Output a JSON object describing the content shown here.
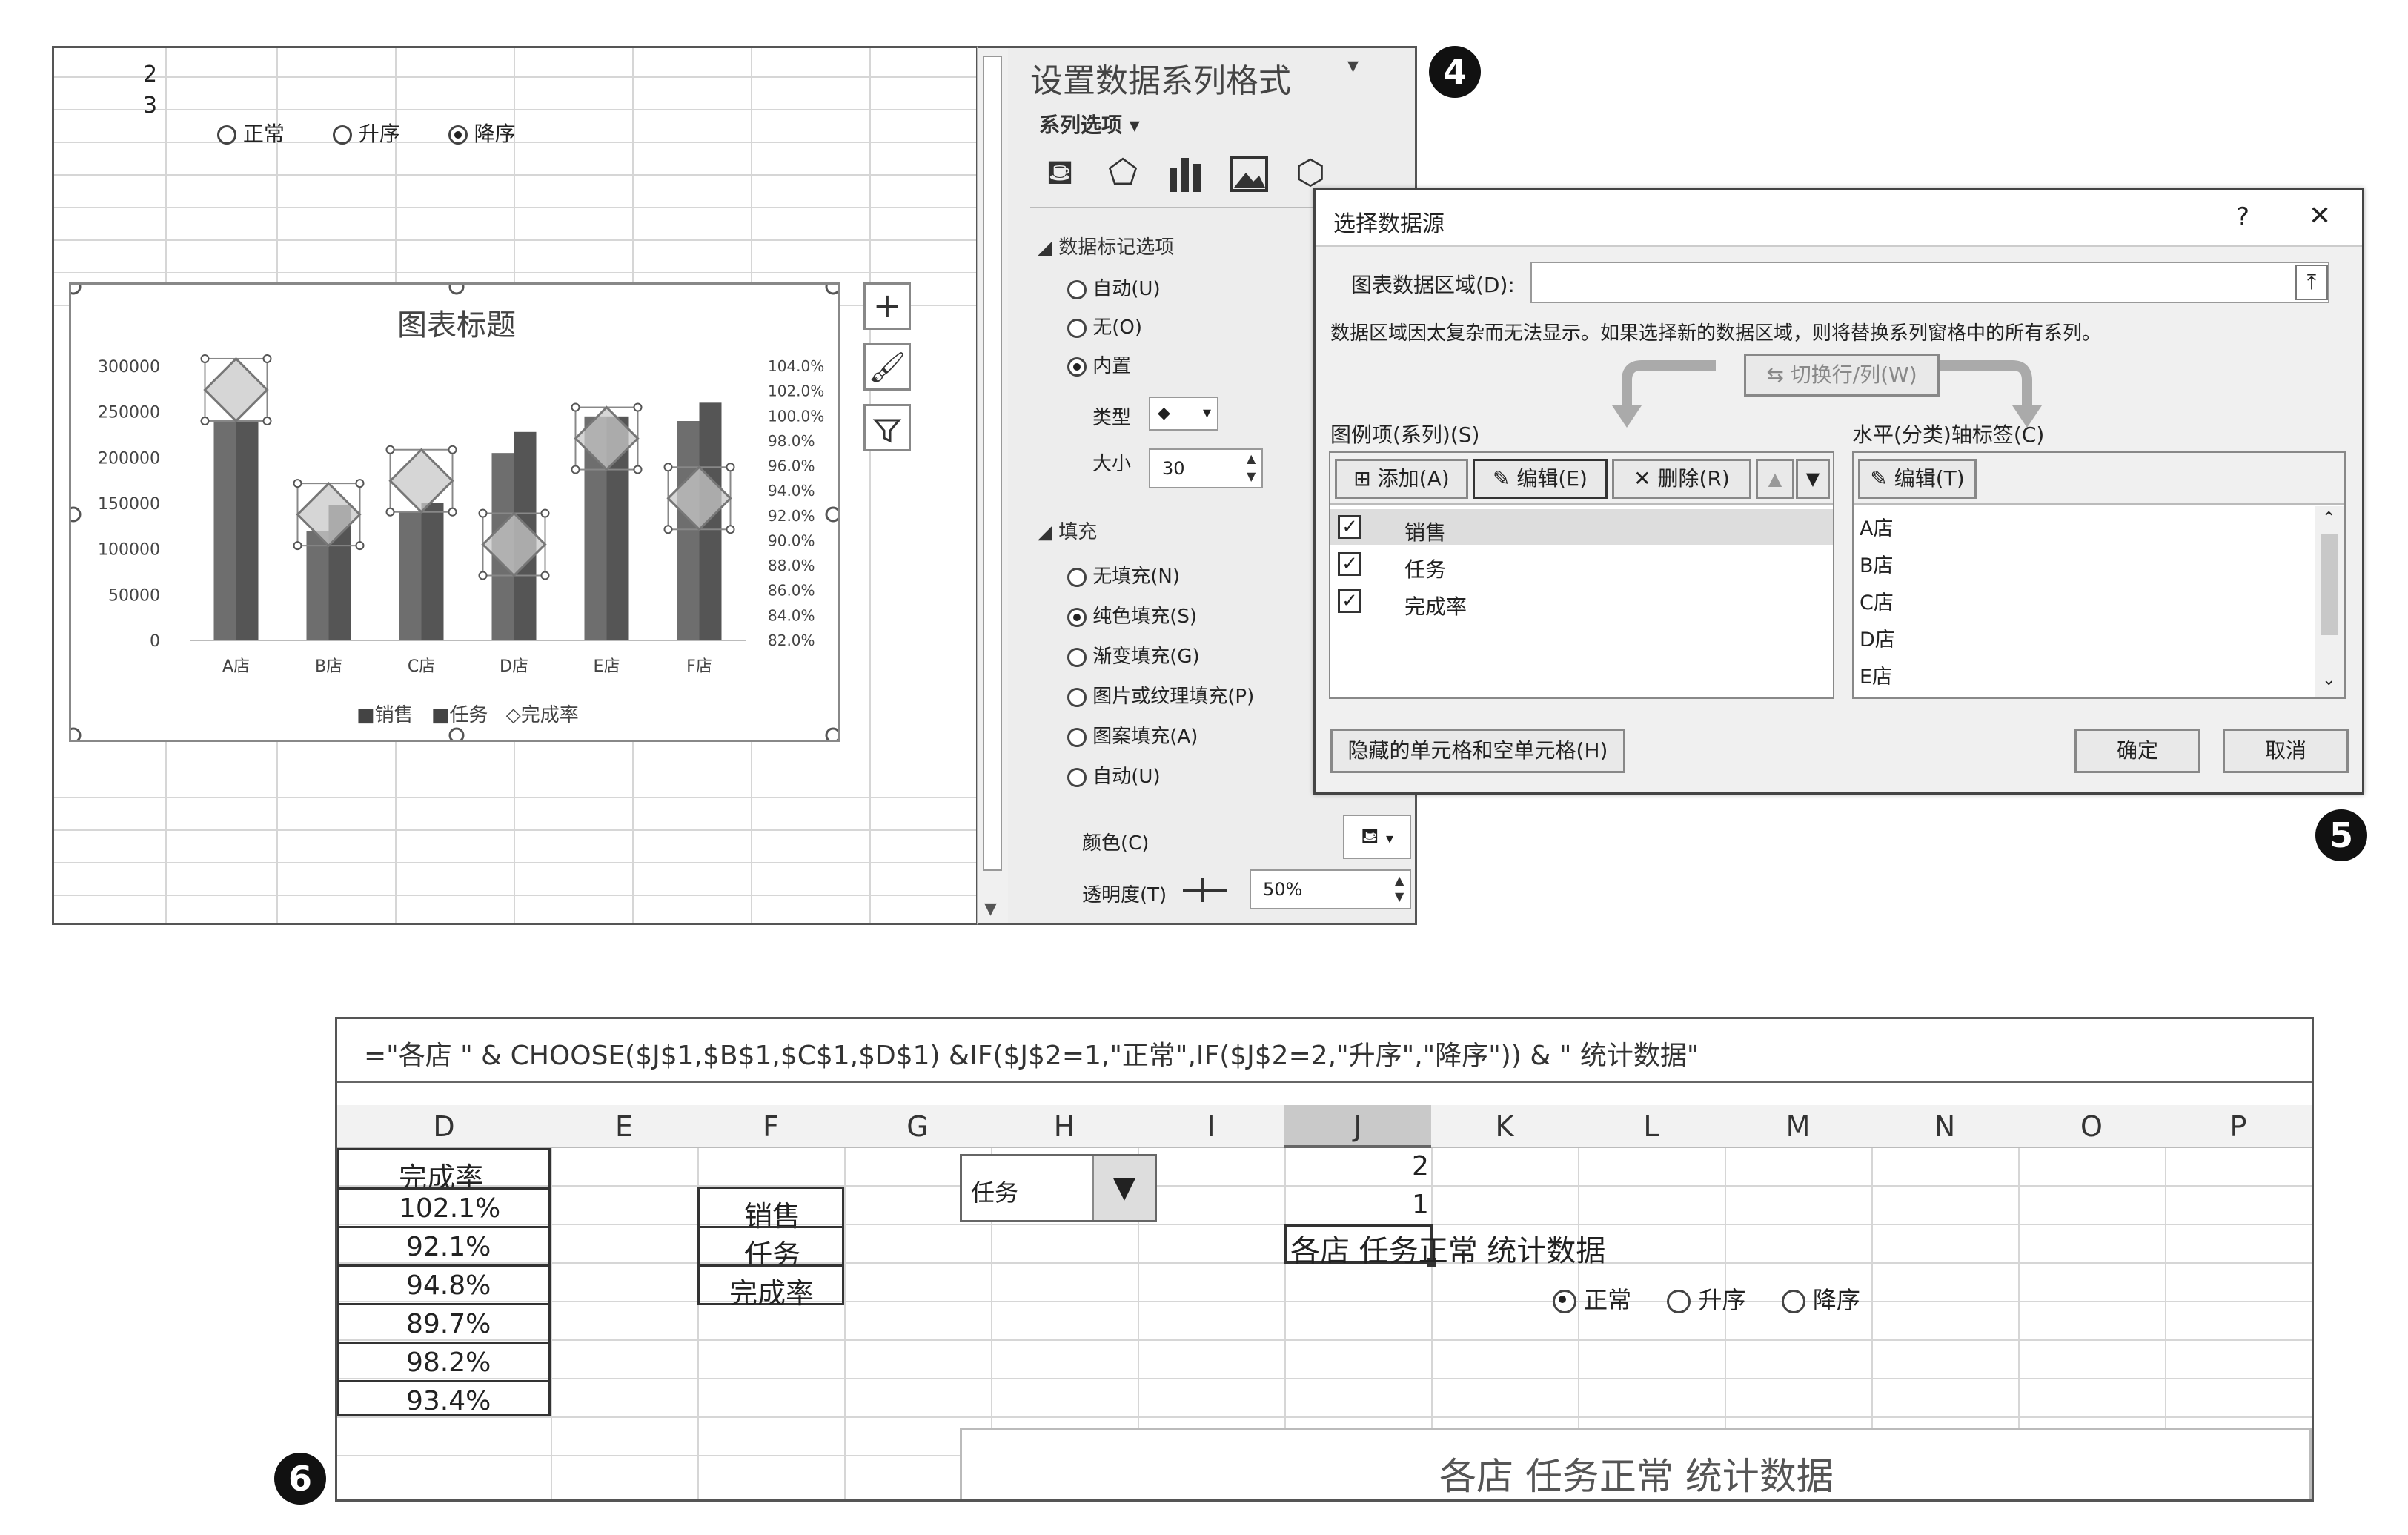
{
  "badges": {
    "step4": "4",
    "step5": "5",
    "step6": "6"
  },
  "sheet_top": {
    "row_numbers": [
      "2",
      "3"
    ],
    "radio_options": [
      {
        "label": "正常",
        "selected": false
      },
      {
        "label": "升序",
        "selected": false
      },
      {
        "label": "降序",
        "selected": true
      }
    ]
  },
  "chart": {
    "title": "图表标题",
    "legend": [
      "销售",
      "任务",
      "完成率"
    ],
    "side_buttons": [
      "plus-icon",
      "brush-icon",
      "filter-icon"
    ]
  },
  "chart_data": {
    "type": "bar",
    "title": "图表标题",
    "categories": [
      "A店",
      "B店",
      "C店",
      "D店",
      "E店",
      "F店"
    ],
    "series": [
      {
        "name": "销售",
        "type": "bar",
        "axis": "left",
        "values": [
          240000,
          120000,
          140000,
          205000,
          245000,
          240000
        ]
      },
      {
        "name": "任务",
        "type": "bar",
        "axis": "left",
        "values": [
          240000,
          148000,
          150000,
          228000,
          245000,
          260000
        ]
      },
      {
        "name": "完成率",
        "type": "scatter",
        "axis": "right",
        "values": [
          1.021,
          0.921,
          0.948,
          0.897,
          0.982,
          0.934
        ]
      }
    ],
    "y_left": {
      "min": 0,
      "max": 300000,
      "ticks": [
        "0",
        "50000",
        "100000",
        "150000",
        "200000",
        "250000",
        "300000"
      ]
    },
    "y_right": {
      "min": 0.82,
      "max": 1.04,
      "ticks": [
        "82.0%",
        "84.0%",
        "86.0%",
        "88.0%",
        "90.0%",
        "92.0%",
        "94.0%",
        "96.0%",
        "98.0%",
        "100.0%",
        "102.0%",
        "104.0%"
      ]
    },
    "legend_position": "bottom"
  },
  "format_pane": {
    "title": "设置数据系列格式",
    "subtitle": "系列选项",
    "section_marker": "数据标记选项",
    "marker_options": [
      {
        "label": "自动(U)",
        "selected": false
      },
      {
        "label": "无(O)",
        "selected": false
      },
      {
        "label": "内置",
        "selected": true
      }
    ],
    "type_label": "类型",
    "type_value": "◆",
    "size_label": "大小",
    "size_value": "30",
    "fill_section": "填充",
    "fill_options": [
      {
        "label": "无填充(N)",
        "selected": false
      },
      {
        "label": "纯色填充(S)",
        "selected": true
      },
      {
        "label": "渐变填充(G)",
        "selected": false
      },
      {
        "label": "图片或纹理填充(P)",
        "selected": false
      },
      {
        "label": "图案填充(A)",
        "selected": false
      },
      {
        "label": "自动(U)",
        "selected": false
      }
    ],
    "color_label": "颜色(C)",
    "transparency_label": "透明度(T)",
    "transparency_value": "50%"
  },
  "dialog": {
    "title": "选择数据源",
    "help": "?",
    "close": "✕",
    "range_label": "图表数据区域(D):",
    "range_value": "",
    "notice": "数据区域因太复杂而无法显示。如果选择新的数据区域，则将替换系列窗格中的所有系列。",
    "switch_button": "切换行/列(W)",
    "legend_header": "图例项(系列)(S)",
    "axis_header": "水平(分类)轴标签(C)",
    "add_button": "添加(A)",
    "edit_button": "编辑(E)",
    "delete_button": "删除(R)",
    "axis_edit_button": "编辑(T)",
    "series": [
      {
        "label": "销售",
        "checked": true
      },
      {
        "label": "任务",
        "checked": true
      },
      {
        "label": "完成率",
        "checked": true
      }
    ],
    "axis_labels": [
      "A店",
      "B店",
      "C店",
      "D店",
      "E店"
    ],
    "hidden_cells_button": "隐藏的单元格和空单元格(H)",
    "ok_button": "确定",
    "cancel_button": "取消"
  },
  "sheet_bottom": {
    "formula": "=\"各店 \" & CHOOSE($J$1,$B$1,$C$1,$D$1) &IF($J$2=1,\"正常\",IF($J$2=2,\"升序\",\"降序\")) & \" 统计数据\"",
    "columns": [
      "D",
      "E",
      "F",
      "G",
      "H",
      "I",
      "J",
      "K",
      "L",
      "M",
      "N",
      "O",
      "P"
    ],
    "d_header": "完成率",
    "d_values": [
      "102.1%",
      "92.1%",
      "94.8%",
      "89.7%",
      "98.2%",
      "93.4%"
    ],
    "f_values": [
      "销售",
      "任务",
      "完成率"
    ],
    "dropdown_value": "任务",
    "j_values": [
      "2",
      "1"
    ],
    "j_text": "各店 任务正常 统计数据",
    "radio_options": [
      {
        "label": "正常",
        "selected": true
      },
      {
        "label": "升序",
        "selected": false
      },
      {
        "label": "降序",
        "selected": false
      }
    ],
    "chart_title": "各店 任务正常 统计数据"
  }
}
